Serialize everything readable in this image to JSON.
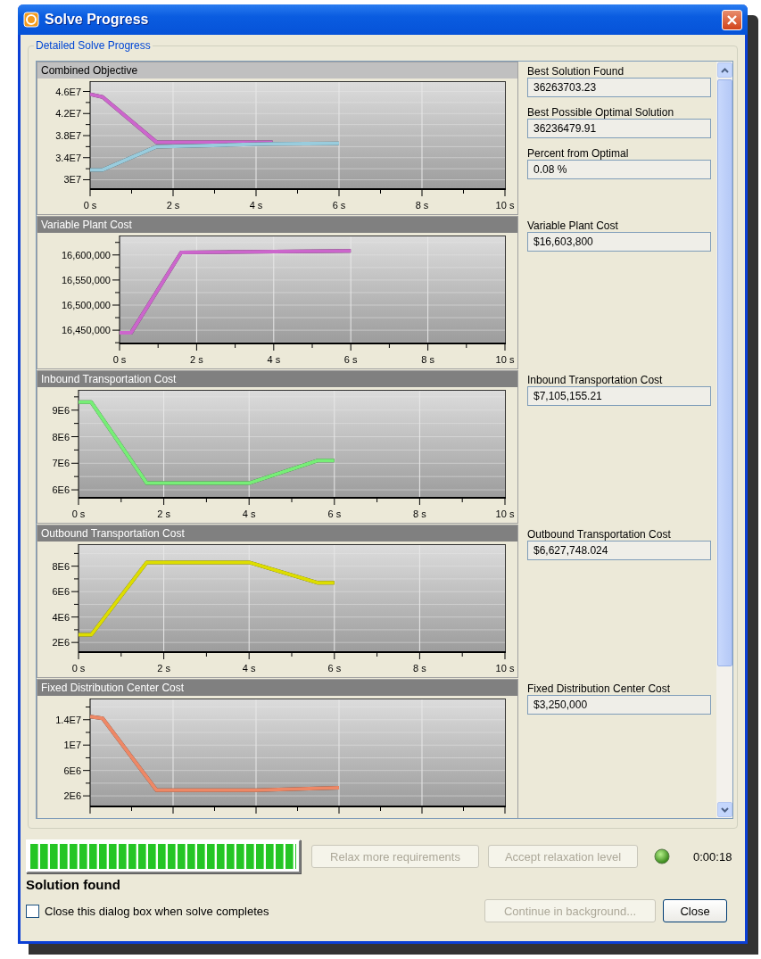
{
  "window": {
    "title": "Solve Progress"
  },
  "group": {
    "title": "Detailed Solve Progress"
  },
  "charts": [
    {
      "title": "Combined Objective",
      "selected": true,
      "fields": [
        {
          "label": "Best Solution Found",
          "value": "36263703.23"
        },
        {
          "label": "Best Possible Optimal Solution",
          "value": "36236479.91"
        },
        {
          "label": "Percent from Optimal",
          "value": "0.08 %"
        }
      ],
      "chart_data": {
        "type": "line",
        "grid": true,
        "x": [
          0,
          0.3,
          1.6,
          4.4,
          6
        ],
        "xlim": [
          0,
          10
        ],
        "ylim": [
          28300000,
          47700000
        ],
        "xticks": [
          {
            "value": 0,
            "label": "0 s"
          },
          {
            "value": 2,
            "label": "2 s"
          },
          {
            "value": 4,
            "label": "4 s"
          },
          {
            "value": 6,
            "label": "6 s"
          },
          {
            "value": 8,
            "label": "8 s"
          },
          {
            "value": 10,
            "label": "10 s"
          }
        ],
        "yticks": [
          {
            "value": 30000000,
            "label": "3E7"
          },
          {
            "value": 34000000,
            "label": "3.4E7"
          },
          {
            "value": 38000000,
            "label": "3.8E7"
          },
          {
            "value": 42000000,
            "label": "4.2E7"
          },
          {
            "value": 46000000,
            "label": "4.6E7"
          }
        ],
        "series": [
          {
            "color": "#cc66cc",
            "values": [
              45500000,
              45000000,
              36800000,
              36800000,
              null
            ]
          },
          {
            "color": "#99ccdd",
            "values": [
              31800000,
              31800000,
              36000000,
              36500000,
              36600000
            ]
          }
        ]
      }
    },
    {
      "title": "Variable Plant Cost",
      "selected": false,
      "fields": [
        {
          "label": "Variable Plant Cost",
          "value": "$16,603,800"
        }
      ],
      "chart_data": {
        "type": "line",
        "grid": true,
        "x": [
          0,
          0.3,
          1.6,
          6
        ],
        "xlim": [
          0,
          10
        ],
        "ylim": [
          16423500,
          16637000
        ],
        "xticks": [
          {
            "value": 0,
            "label": "0 s"
          },
          {
            "value": 2,
            "label": "2 s"
          },
          {
            "value": 4,
            "label": "4 s"
          },
          {
            "value": 6,
            "label": "6 s"
          },
          {
            "value": 8,
            "label": "8 s"
          },
          {
            "value": 10,
            "label": "10 s"
          }
        ],
        "yticks": [
          {
            "value": 16450000,
            "label": "16,450,000"
          },
          {
            "value": 16500000,
            "label": "16,500,000"
          },
          {
            "value": 16550000,
            "label": "16,550,000"
          },
          {
            "value": 16600000,
            "label": "16,600,000"
          }
        ],
        "series": [
          {
            "color": "#cc66cc",
            "values": [
              16445000,
              16445000,
              16605000,
              16608000
            ]
          }
        ]
      }
    },
    {
      "title": "Inbound Transportation Cost",
      "selected": false,
      "fields": [
        {
          "label": "Inbound Transportation Cost",
          "value": "$7,105,155.21"
        }
      ],
      "chart_data": {
        "type": "line",
        "grid": true,
        "x": [
          0,
          0.3,
          1.6,
          4,
          5.6,
          6
        ],
        "xlim": [
          0,
          10
        ],
        "ylim": [
          5700000,
          9730000
        ],
        "xticks": [
          {
            "value": 0,
            "label": "0 s"
          },
          {
            "value": 2,
            "label": "2 s"
          },
          {
            "value": 4,
            "label": "4 s"
          },
          {
            "value": 6,
            "label": "6 s"
          },
          {
            "value": 8,
            "label": "8 s"
          },
          {
            "value": 10,
            "label": "10 s"
          }
        ],
        "yticks": [
          {
            "value": 6000000,
            "label": "6E6"
          },
          {
            "value": 7000000,
            "label": "7E6"
          },
          {
            "value": 8000000,
            "label": "8E6"
          },
          {
            "value": 9000000,
            "label": "9E6"
          }
        ],
        "series": [
          {
            "color": "#77ee77",
            "values": [
              9300000,
              9300000,
              6250000,
              6250000,
              7100000,
              7100000
            ]
          }
        ]
      }
    },
    {
      "title": "Outbound Transportation Cost",
      "selected": false,
      "fields": [
        {
          "label": "Outbound Transportation Cost",
          "value": "$6,627,748.024"
        }
      ],
      "chart_data": {
        "type": "line",
        "grid": true,
        "x": [
          0,
          0.3,
          1.6,
          4,
          5.6,
          6
        ],
        "xlim": [
          0,
          10
        ],
        "ylim": [
          1240000,
          9660000
        ],
        "xticks": [
          {
            "value": 0,
            "label": "0 s"
          },
          {
            "value": 2,
            "label": "2 s"
          },
          {
            "value": 4,
            "label": "4 s"
          },
          {
            "value": 6,
            "label": "6 s"
          },
          {
            "value": 8,
            "label": "8 s"
          },
          {
            "value": 10,
            "label": "10 s"
          }
        ],
        "yticks": [
          {
            "value": 2000000,
            "label": "2E6"
          },
          {
            "value": 4000000,
            "label": "4E6"
          },
          {
            "value": 6000000,
            "label": "6E6"
          },
          {
            "value": 8000000,
            "label": "8E6"
          }
        ],
        "series": [
          {
            "color": "#dddd00",
            "values": [
              2600000,
              2600000,
              8300000,
              8300000,
              6700000,
              6700000
            ]
          }
        ]
      }
    },
    {
      "title": "Fixed Distribution Center Cost",
      "selected": false,
      "fields": [
        {
          "label": "Fixed Distribution Center Cost",
          "value": "$3,250,000"
        }
      ],
      "chart_data": {
        "type": "line",
        "grid": true,
        "x": [
          0,
          0.3,
          1.6,
          4,
          6
        ],
        "xlim": [
          0,
          10
        ],
        "ylim": [
          330000,
          17200000
        ],
        "yticks": [
          {
            "value": 2000000,
            "label": "2E6"
          },
          {
            "value": 6000000,
            "label": "6E6"
          },
          {
            "value": 10000000,
            "label": "1E7"
          },
          {
            "value": 14000000,
            "label": "1.4E7"
          }
        ],
        "series": [
          {
            "color": "#ee8866",
            "values": [
              14500000,
              14200000,
              2900000,
              2900000,
              3300000
            ]
          }
        ]
      }
    }
  ],
  "progress": {
    "level": 1,
    "status": "Solution found"
  },
  "buttons": [
    {
      "label": "Relax more requirements",
      "disabled": true
    },
    {
      "label": "Accept relaxation level",
      "disabled": true
    }
  ],
  "elapsed": "0:00:18",
  "close_on_complete": {
    "label": "Close this dialog box when solve completes",
    "checked": false
  },
  "footer_buttons": [
    {
      "label": "Continue in background...",
      "disabled": true
    },
    {
      "label": "Close",
      "disabled": false
    }
  ]
}
